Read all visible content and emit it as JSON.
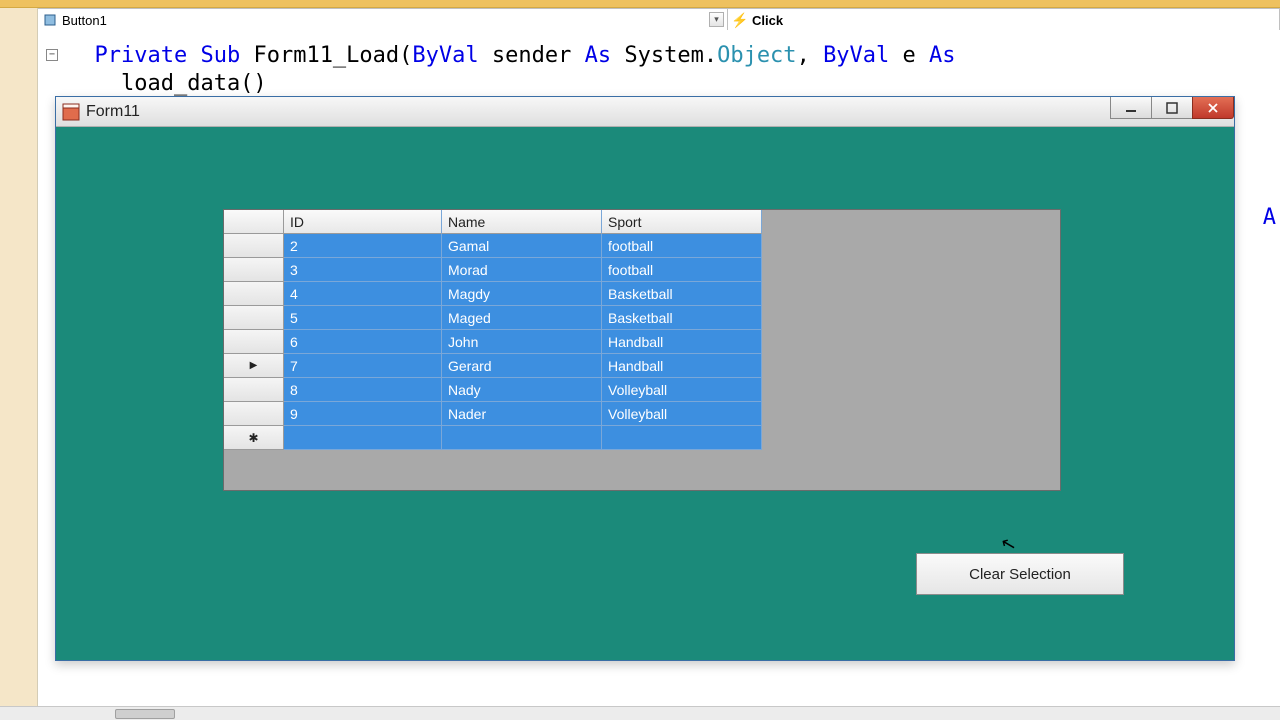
{
  "toolbar": {
    "object_selector": "Button1",
    "event_selector": "Click"
  },
  "code": {
    "line1_keyword1": "Private",
    "line1_keyword2": "Sub",
    "line1_name": " Form11_Load(",
    "line1_keyword3": "ByVal",
    "line1_arg1": " sender ",
    "line1_keyword4": "As",
    "line1_sys": " System.",
    "line1_type": "Object",
    "line1_comma": ", ",
    "line1_keyword5": "ByVal",
    "line1_arg2": " e ",
    "line1_keyword6": "As",
    "line2_body": "    load_data()",
    "partial_A": "A"
  },
  "window": {
    "title": "Form11",
    "ghost": "  "
  },
  "grid": {
    "headers": {
      "id": "ID",
      "name": "Name",
      "sport": "Sport"
    },
    "rows": [
      {
        "id": "2",
        "name": "Gamal",
        "sport": "football"
      },
      {
        "id": "3",
        "name": "Morad",
        "sport": "football"
      },
      {
        "id": "4",
        "name": "Magdy",
        "sport": "Basketball"
      },
      {
        "id": "5",
        "name": "Maged",
        "sport": "Basketball"
      },
      {
        "id": "6",
        "name": "John",
        "sport": "Handball"
      },
      {
        "id": "7",
        "name": "Gerard",
        "sport": "Handball"
      },
      {
        "id": "8",
        "name": "Nady",
        "sport": "Volleyball"
      },
      {
        "id": "9",
        "name": "Nader",
        "sport": "Volleyball"
      }
    ],
    "current_row_index": 5
  },
  "buttons": {
    "clear_selection": "Clear Selection"
  }
}
